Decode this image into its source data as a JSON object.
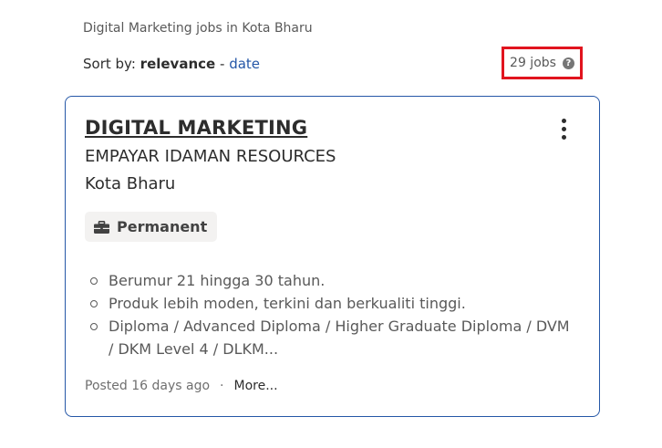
{
  "breadcrumb": "Digital Marketing jobs in Kota Bharu",
  "sort": {
    "prefix": "Sort by:",
    "active": "relevance",
    "separator": "-",
    "option": "date"
  },
  "results": {
    "count_text": "29 jobs",
    "help_icon": "question-circle-icon",
    "help_glyph": "?",
    "highlight_color": "#e1141e"
  },
  "job": {
    "title": "DIGITAL MARKETING",
    "company": "EMPAYAR IDAMAN RESOURCES",
    "location": "Kota Bharu",
    "tag": "Permanent",
    "tag_icon": "briefcase-icon",
    "menu_icon": "kebab-menu-icon",
    "snippet": [
      "Berumur 21 hingga 30 tahun.",
      "Produk lebih moden, terkini dan berkualiti tinggi.",
      "Diploma / Advanced Diploma / Higher Graduate Diploma / DVM / DKM Level 4 / DLKM..."
    ],
    "posted": "Posted 16 days ago",
    "dot": "·",
    "more": "More..."
  },
  "colors": {
    "card_border": "#2557a7",
    "link": "#2557a7",
    "tag_bg": "#f3f2f1"
  }
}
